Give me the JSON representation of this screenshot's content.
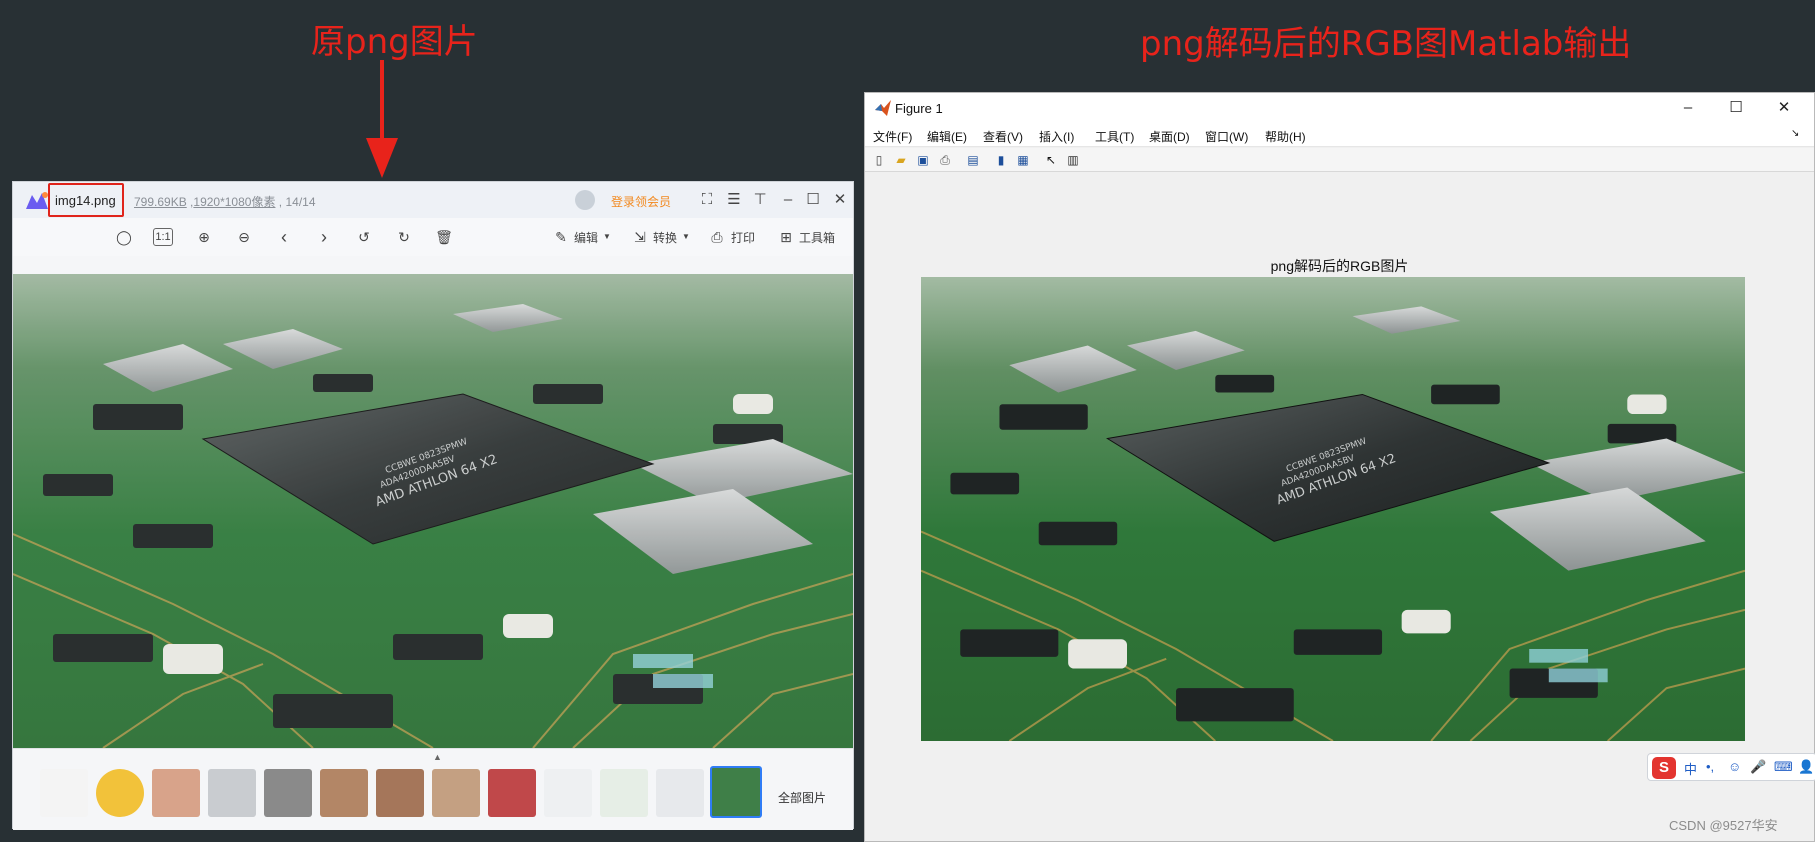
{
  "annotations": {
    "left": "原png图片",
    "right": "png解码后的RGB图Matlab输出"
  },
  "viewer": {
    "filename": "img14.png",
    "size": "799.69KB",
    "resolution": "1920*1080像素",
    "counter": "14/14",
    "vip_label": "登录领会员",
    "toolbar": {
      "edit": "编辑",
      "convert": "转换",
      "print": "打印",
      "tools": "工具箱"
    },
    "all_pictures": "全部图片",
    "chip_text_1": "AMD ATHLON 64 X2",
    "chip_text_2": "ADA4200DAA5BV",
    "chip_text_3": "CCBWE 0823SPMW"
  },
  "figure": {
    "window_title": "Figure 1",
    "menu": [
      "文件(F)",
      "编辑(E)",
      "查看(V)",
      "插入(I)",
      "工具(T)",
      "桌面(D)",
      "窗口(W)",
      "帮助(H)"
    ],
    "axes_title": "png解码后的RGB图片",
    "ime_label": "中",
    "watermark": "CSDN @9527华安"
  },
  "colors": {
    "annotation": "#e8231b",
    "vip": "#f2891f",
    "selected_thumb": "#2f7cf6",
    "board_green": "#2e7a3c"
  }
}
